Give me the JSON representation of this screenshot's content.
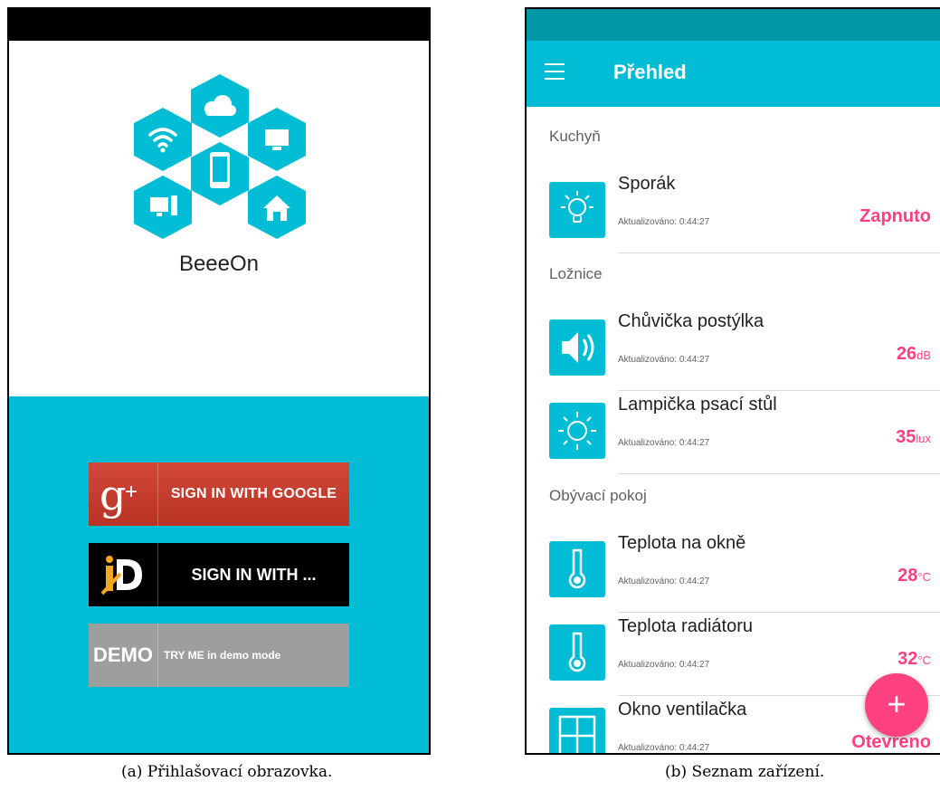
{
  "screen_a": {
    "app_name": "BeeeOn",
    "buttons": {
      "google_label": "SIGN IN WITH GOOGLE",
      "mojeid_label": "SIGN IN WITH ...",
      "demo_icon_text": "DEMO",
      "demo_label": "TRY ME in demo mode"
    },
    "caption": "(a) Přihlašovací obrazovka."
  },
  "screen_b": {
    "title": "Přehled",
    "sections": [
      {
        "name": "Kuchyň"
      },
      {
        "name": "Ložnice"
      },
      {
        "name": "Obývací pokoj"
      }
    ],
    "devices": [
      {
        "name": "Sporák",
        "updated": "Aktualizováno: 0:44:27",
        "value": "Zapnuto",
        "unit": "",
        "icon": "bulb-icon"
      },
      {
        "name": "Chůvička postýlka",
        "updated": "Aktualizováno: 0:44:27",
        "value": "26",
        "unit": "dB",
        "icon": "speaker-icon"
      },
      {
        "name": "Lampička psací stůl",
        "updated": "Aktualizováno: 0:44:27",
        "value": "35",
        "unit": "lux",
        "icon": "sun-icon"
      },
      {
        "name": "Teplota na okně",
        "updated": "Aktualizováno: 0:44:27",
        "value": "28",
        "unit": "°C",
        "icon": "thermometer-icon"
      },
      {
        "name": "Teplota radiátoru",
        "updated": "Aktualizováno: 0:44:27",
        "value": "32",
        "unit": "°C",
        "icon": "thermometer-icon"
      },
      {
        "name": "Okno ventilačka",
        "updated": "Aktualizováno: 0:44:27",
        "value": "Otevřeno",
        "unit": "",
        "icon": "window-icon"
      }
    ],
    "fab_label": "+",
    "caption": "(b) Seznam zařízení."
  },
  "colors": {
    "primary": "#00bcd4",
    "primary_dark": "#0097a7",
    "accent": "#ff4081"
  }
}
